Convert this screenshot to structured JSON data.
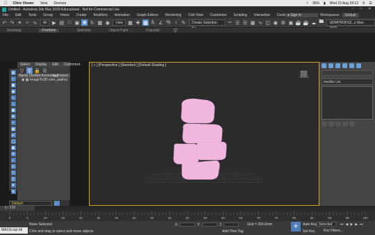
{
  "mac": {
    "app": "Citrix Viewer",
    "menus": [
      "View",
      "Devices"
    ],
    "battery": "36%",
    "datetime": "Wed 10 Aug 18:13"
  },
  "title": "Untitled - Autodesk 3ds Max 2020 Educational - Not for Commercial Use",
  "menubar": {
    "items": [
      "File",
      "Edit",
      "Tools",
      "Group",
      "Views",
      "Create",
      "Modifiers",
      "Animation",
      "Graph Editors",
      "Rendering",
      "Civil View",
      "Customize",
      "Scripting",
      "Interactive",
      "Content"
    ],
    "sign_in": "Sign In",
    "workspaces_label": "Workspaces:",
    "workspaces_value": "Default"
  },
  "toolbar": {
    "filter": "All",
    "view": "View",
    "selection_set": "Create Selection Se",
    "project": "\\3DMPROFS3...s Max 2020"
  },
  "ribbon": {
    "tabs": [
      "Modeling",
      "Freeform",
      "Selection",
      "Object Paint",
      "Populate"
    ],
    "active": "Freeform"
  },
  "explorer": {
    "tabs": [
      "Select",
      "Display",
      "Edit",
      "Customize"
    ],
    "header": "Name (Sorted Ascending)",
    "frozen_label": "▲ Frozen",
    "item": "ImageTo3D.com_audrey"
  },
  "viewport": {
    "label": "[ + ] [Perspective ] [Standard ] [Default Shading ]"
  },
  "command_panel": {
    "modifier_list": "Modifier List"
  },
  "layer": {
    "name": "Default"
  },
  "timeline": {
    "slider": "0 / 100",
    "ticks": [
      "0",
      "5",
      "10",
      "15",
      "20",
      "25",
      "30",
      "35",
      "40",
      "45",
      "50",
      "55",
      "60",
      "65",
      "70",
      "75",
      "80",
      "85",
      "90",
      "95",
      "100"
    ]
  },
  "status": {
    "maxscript": "MAXScript Mi",
    "selection": "None Selected",
    "hint": "Click and drag to select and move objects",
    "x_label": "X:",
    "y_label": "Y:",
    "z_label": "Z:",
    "grid": "Grid = 254,0mm",
    "add_time_tag": "Add Time Tag",
    "auto_key": "Auto Key",
    "set_key": "Set Key",
    "selected": "Selected",
    "key_filters": "Key Filters..."
  },
  "colors": {
    "accent_blue": "#5c8fcc",
    "viewport_border": "#d3a41a",
    "mesh_pink": "#f0b6dd"
  }
}
